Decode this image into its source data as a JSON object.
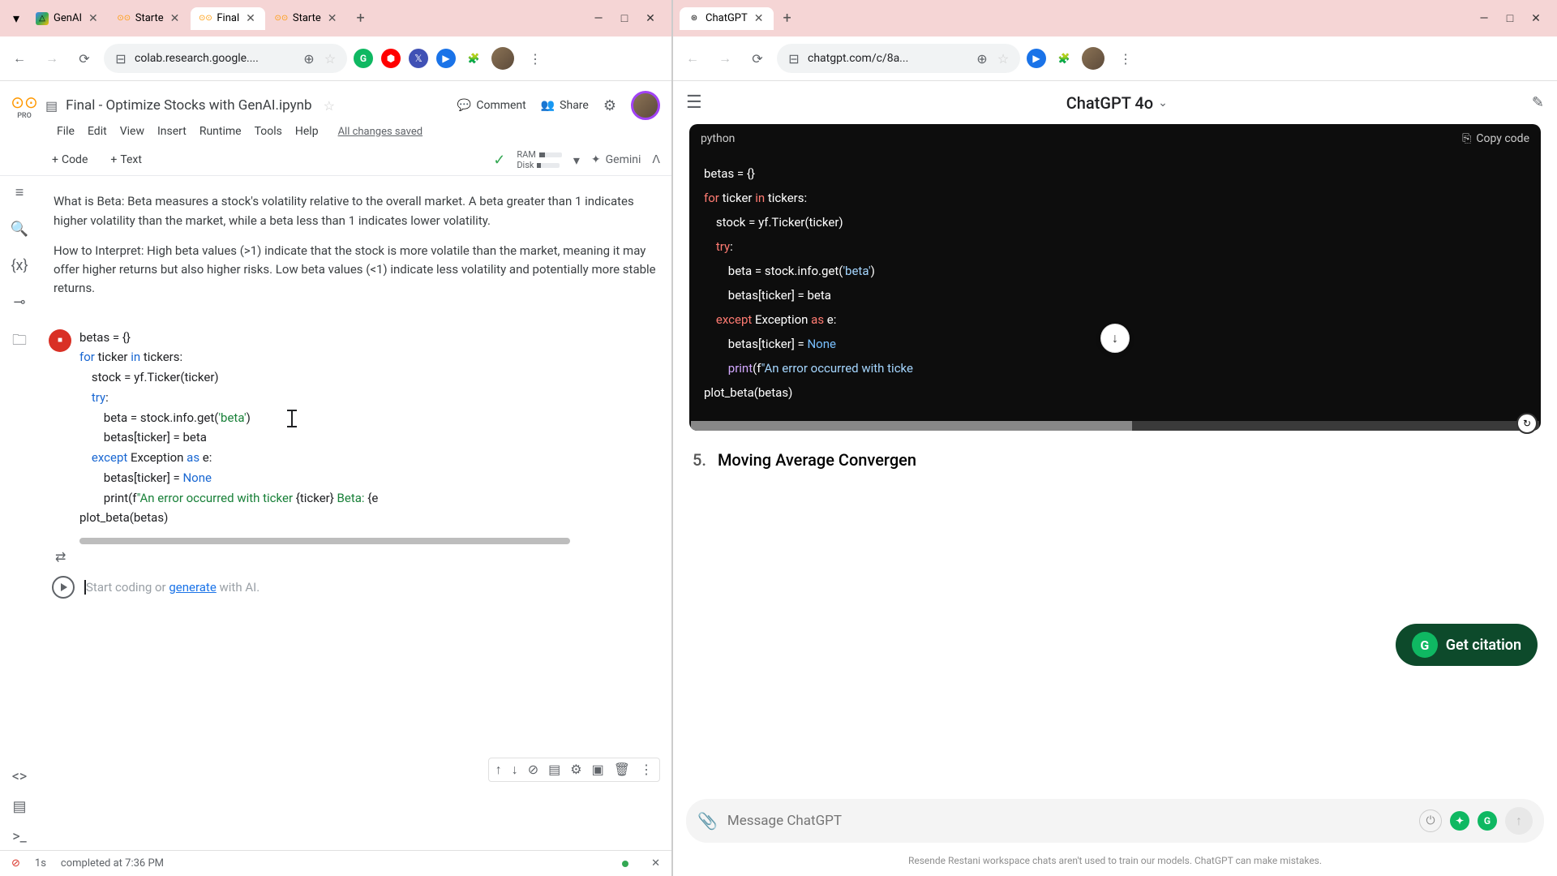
{
  "left_window": {
    "tabs": [
      {
        "label": "GenAI",
        "favicon": "gdrive"
      },
      {
        "label": "Starte",
        "favicon": "colab"
      },
      {
        "label": "Final",
        "favicon": "colab",
        "active": true
      },
      {
        "label": "Starte",
        "favicon": "colab"
      }
    ],
    "url": "colab.research.google....",
    "colab": {
      "pro_label": "PRO",
      "title": "Final - Optimize Stocks with GenAI.ipynb",
      "menus": [
        "File",
        "Edit",
        "View",
        "Insert",
        "Runtime",
        "Tools",
        "Help"
      ],
      "changes": "All changes saved",
      "actions": {
        "comment": "Comment",
        "share": "Share"
      },
      "toolbar": {
        "code": "Code",
        "text": "Text",
        "ram": "RAM",
        "disk": "Disk",
        "gemini": "Gemini"
      }
    },
    "text_cell": {
      "p1": "What is Beta: Beta measures a stock's volatility relative to the overall market. A beta greater than 1 indicates higher volatility than the market, while a beta less than 1 indicates lower volatility.",
      "p2": "How to Interpret: High beta values (>1) indicate that the stock is more volatile than the market, meaning it may offer higher returns but also higher risks. Low beta values (<1) indicate less volatility and potentially more stable returns."
    },
    "code": {
      "l1": "betas = {}",
      "l2a": "for",
      "l2b": " ticker ",
      "l2c": "in",
      "l2d": " tickers:",
      "l3": "    stock = yf.Ticker(ticker)",
      "l4a": "    ",
      "l4b": "try",
      "l4c": ":",
      "l5a": "        beta = stock.info.get(",
      "l5b": "'beta'",
      "l5c": ")",
      "l6": "        betas[ticker] = beta",
      "l7a": "    ",
      "l7b": "except",
      "l7c": " Exception ",
      "l7d": "as",
      "l7e": " e:",
      "l8a": "        betas[ticker] = ",
      "l8b": "None",
      "l9a": "        print(f",
      "l9b": "\"An error occurred with ticker ",
      "l9c": "{ticker}",
      "l9d": " Beta: ",
      "l9e": "{e",
      "l10": "plot_beta(betas)"
    },
    "empty_cell": {
      "prefix": "Start coding or ",
      "link": "generate",
      "suffix": " with AI."
    },
    "status": {
      "time": "1s",
      "completed": "completed at 7:36 PM"
    }
  },
  "right_window": {
    "tab": {
      "label": "ChatGPT"
    },
    "url": "chatgpt.com/c/8a...",
    "header": {
      "title": "ChatGPT 4o"
    },
    "code_block": {
      "lang": "python",
      "copy": "Copy code",
      "l1": "betas = {}",
      "l2a": "for",
      "l2b": " ticker ",
      "l2c": "in",
      "l2d": " tickers:",
      "l3": "    stock = yf.Ticker(ticker)",
      "l4a": "    ",
      "l4b": "try",
      "l4c": ":",
      "l5a": "        beta = stock.info.get(",
      "l5b": "'beta'",
      "l5c": ")",
      "l6": "        betas[ticker] = beta",
      "l7a": "    ",
      "l7b": "except",
      "l7c": " Exception ",
      "l7d": "as",
      "l7e": " e:",
      "l8a": "        betas[ticker] = ",
      "l8b": "None",
      "l9a": "        ",
      "l9b": "print",
      "l9c": "(f",
      "l9d": "\"An error occurred with ticke",
      "l10": "plot_beta(betas)"
    },
    "next_section": {
      "num": "5.",
      "title": "Moving Average Convergen"
    },
    "citation": "Get citation",
    "input": {
      "placeholder": "Message ChatGPT"
    },
    "footer": "Resende Restani workspace chats aren't used to train our models. ChatGPT can make mistakes."
  }
}
